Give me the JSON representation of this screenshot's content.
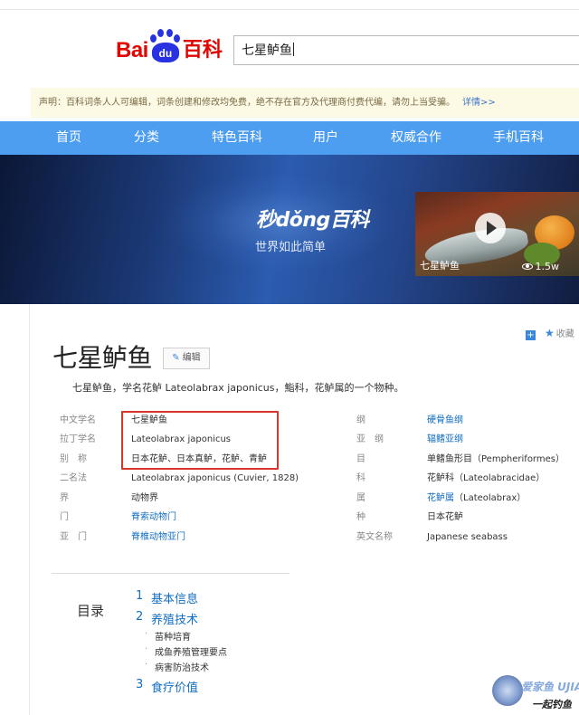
{
  "header": {
    "logo": {
      "bai": "Bai",
      "du": "du",
      "baike": "百科"
    },
    "search_value": "七星鲈鱼"
  },
  "notice": {
    "text": "声明：百科词条人人可编辑，词条创建和修改均免费，绝不存在官方及代理商付费代编，请勿上当受骗。",
    "more": "详情>>"
  },
  "nav": {
    "items": [
      "首页",
      "分类",
      "特色百科",
      "用户",
      "权威合作",
      "手机百科"
    ]
  },
  "banner": {
    "logo": "秒dǒng百科",
    "slogan": "世界如此简单",
    "video": {
      "title": "七星鲈鱼",
      "views": "1.5w"
    }
  },
  "side_tools": {
    "favorite": "收藏"
  },
  "entry": {
    "title": "七星鲈鱼",
    "edit_label": "编辑",
    "summary": "七星鲈鱼，学名花鲈 Lateolabrax japonicus，鮨科，花鲈属的一个物种。"
  },
  "info_left": [
    {
      "k": "中文学名",
      "v": "七星鲈鱼",
      "link": false
    },
    {
      "k": "拉丁学名",
      "v": "Lateolabrax japonicus",
      "link": false
    },
    {
      "k": "别　称",
      "v": "日本花鲈、日本真鲈，花鲈、青鲈",
      "link": false
    },
    {
      "k": "二名法",
      "v": "Lateolabrax japonicus (Cuvier, 1828)",
      "link": false
    },
    {
      "k": "界",
      "v": "动物界",
      "link": false
    },
    {
      "k": "门",
      "v": "脊索动物门",
      "link": true
    },
    {
      "k": "亚　门",
      "v": "脊椎动物亚门",
      "link": true
    }
  ],
  "info_right": [
    {
      "k": "纲",
      "v": "硬骨鱼纲",
      "link": true
    },
    {
      "k": "亚　纲",
      "v": "辐鳍亚纲",
      "link": true
    },
    {
      "k": "目",
      "v": "单鳍鱼形目（Pempheriformes）",
      "link": false
    },
    {
      "k": "科",
      "v": "花鲈科（Lateolabracidae）",
      "link": false
    },
    {
      "k": "属",
      "v": "花鲈属（Lateolabrax）",
      "link": false,
      "link_part": "花鲈属",
      "rest": "（Lateolabrax）"
    },
    {
      "k": "种",
      "v": "日本花鲈",
      "link": false
    },
    {
      "k": "英文名称",
      "v": "Japanese seabass",
      "link": false
    }
  ],
  "toc": {
    "title": "目录",
    "items": [
      {
        "num": "1",
        "label": "基本信息"
      },
      {
        "num": "2",
        "label": "养殖技术",
        "subs": [
          "苗种培育",
          "成鱼养殖管理要点",
          "病害防治技术"
        ]
      },
      {
        "num": "3",
        "label": "食疗价值"
      }
    ]
  },
  "watermark": {
    "text": "爱家鱼 UJIAYU",
    "sub": "一起钓鱼"
  }
}
